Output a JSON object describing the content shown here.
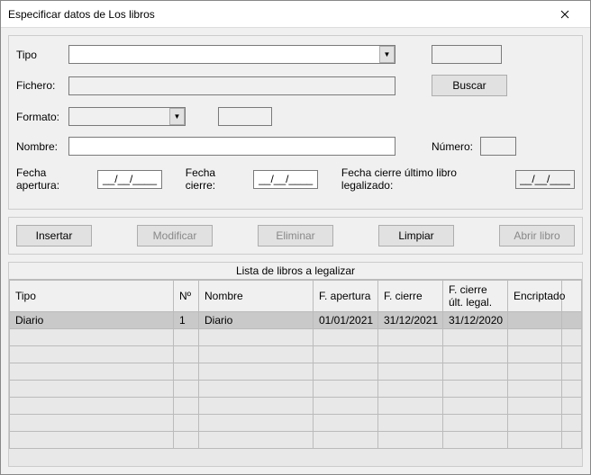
{
  "window": {
    "title": "Especificar datos de Los libros"
  },
  "form": {
    "tipo_label": "Tipo",
    "tipo_value": "",
    "extra_box_value": "",
    "fichero_label": "Fichero:",
    "fichero_value": "",
    "buscar_label": "Buscar",
    "formato_label": "Formato:",
    "formato_value": "",
    "formato_aux_value": "",
    "nombre_label": "Nombre:",
    "nombre_value": "",
    "numero_label": "Número:",
    "numero_value": "",
    "fecha_apertura_label": "Fecha apertura:",
    "fecha_apertura_value": "__/__/____",
    "fecha_cierre_label": "Fecha cierre:",
    "fecha_cierre_value": "__/__/____",
    "fecha_cierre_ult_label": "Fecha cierre último libro legalizado:",
    "fecha_cierre_ult_value": "__/__/____"
  },
  "buttons": {
    "insertar": "Insertar",
    "modificar": "Modificar",
    "eliminar": "Eliminar",
    "limpiar": "Limpiar",
    "abrir": "Abrir libro"
  },
  "list": {
    "title": "Lista de libros a legalizar",
    "headers": {
      "tipo": "Tipo",
      "n": "Nº",
      "nombre": "Nombre",
      "fap": "F. apertura",
      "fci": "F. cierre",
      "fcu": "F. cierre  últ. legal.",
      "enc": "Encriptado"
    },
    "rows": [
      {
        "tipo": "Diario",
        "n": "1",
        "nombre": "Diario",
        "fap": "01/01/2021",
        "fci": "31/12/2021",
        "fcu": "31/12/2020",
        "enc": ""
      }
    ]
  }
}
